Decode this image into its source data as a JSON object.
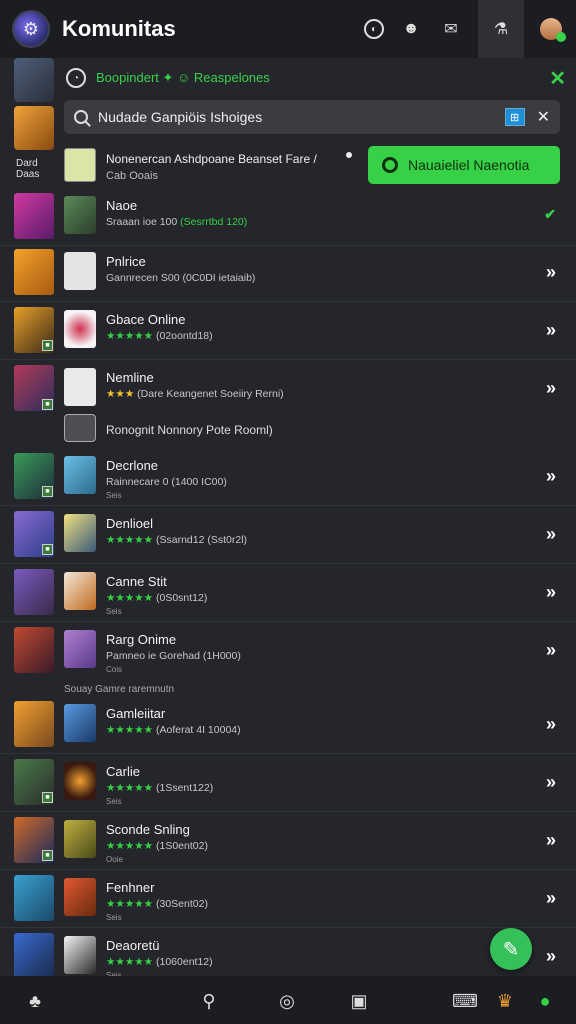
{
  "header": {
    "title": "Komunitas",
    "icons": [
      "compass-icon",
      "user-avatar-icon",
      "mail-icon",
      "hardware-icon",
      "profile-icon"
    ]
  },
  "rail": {
    "label": "Dard Daas"
  },
  "notification": {
    "text": "Boopindert ✦ ☺ Reaspelones",
    "close": "✕"
  },
  "search": {
    "placeholder": "Nudade Ganpiöis Ishoiges",
    "clear": "✕",
    "filter_icon": "filter-icon"
  },
  "featured": {
    "title": "Nonenercan Ashdpoane Beanset Fare /",
    "subtitle": "Cab Ooais",
    "cta_label": "Nauaieliel Naenotia"
  },
  "list": [
    {
      "title": "Naoe",
      "meta": "Sraaan ioe 100 ",
      "meta_green": "(Sesrrtbd 120)",
      "extra": "",
      "arrow": "✔"
    },
    {
      "title": "Pnlrice",
      "meta": "Gannrecen S00 (0C0DI ietaiaib)",
      "meta_green": "",
      "extra": "",
      "arrow": "»"
    },
    {
      "title": "Gbace Online",
      "stars": "★★★★★",
      "meta": " (02oontd18)",
      "extra": "",
      "arrow": "»"
    },
    {
      "title": "Nemline",
      "stars_gold": "★★★",
      "meta": " (Dare Keangenet Soeiiry Rerni)",
      "extra": "",
      "arrow": "»"
    },
    {
      "title": "Decrlone",
      "meta": "Rainnecare 0 (1400 IC00)",
      "extra": "Seis",
      "arrow": "»"
    },
    {
      "title": "Denlioel",
      "stars": "★★★★★",
      "meta": " (Ssarnd12 (Sst0r2l)",
      "extra": "",
      "arrow": "»"
    },
    {
      "title": "Canne Stit",
      "stars": "★★★★★",
      "meta": " (0S0snt12)",
      "extra": "Seis",
      "arrow": "»"
    },
    {
      "title": "Rarg Onime",
      "meta": "Pamneo ie Gorehad (1H000)",
      "extra": "Cois",
      "arrow": "»"
    },
    {
      "title": "Gamleiitar",
      "stars": "★★★★★",
      "meta": " (Aoferat 4I 10004)",
      "extra": "",
      "arrow": "»"
    },
    {
      "title": "Carlie",
      "stars": "★★★★★",
      "meta": " (1Ssent122)",
      "extra": "Seis",
      "arrow": "»"
    },
    {
      "title": "Sconde Snling",
      "stars": "★★★★★",
      "meta": " (1S0ent02)",
      "extra": "Ooie",
      "arrow": "»"
    },
    {
      "title": "Fenhner",
      "stars": "★★★★★",
      "meta": " (30Sent02)",
      "extra": "Seis",
      "arrow": "»"
    },
    {
      "title": "Deaoretü",
      "stars": "★★★★★",
      "meta": " (1060ent12)",
      "extra": "Seis",
      "arrow": "»"
    }
  ],
  "sub_row": {
    "text": "Ronognit Nonnory Pote Rooml)"
  },
  "section_label": "Souay Gamre raremnutn",
  "colors": {
    "accent": "#36d146",
    "background": "#24262b",
    "header": "#1b1d21"
  },
  "bottom_nav": {
    "icons": [
      "community-icon",
      "search-icon",
      "compass-icon",
      "calendar-icon",
      "controller-icon",
      "crown-icon",
      "profile-icon"
    ]
  }
}
